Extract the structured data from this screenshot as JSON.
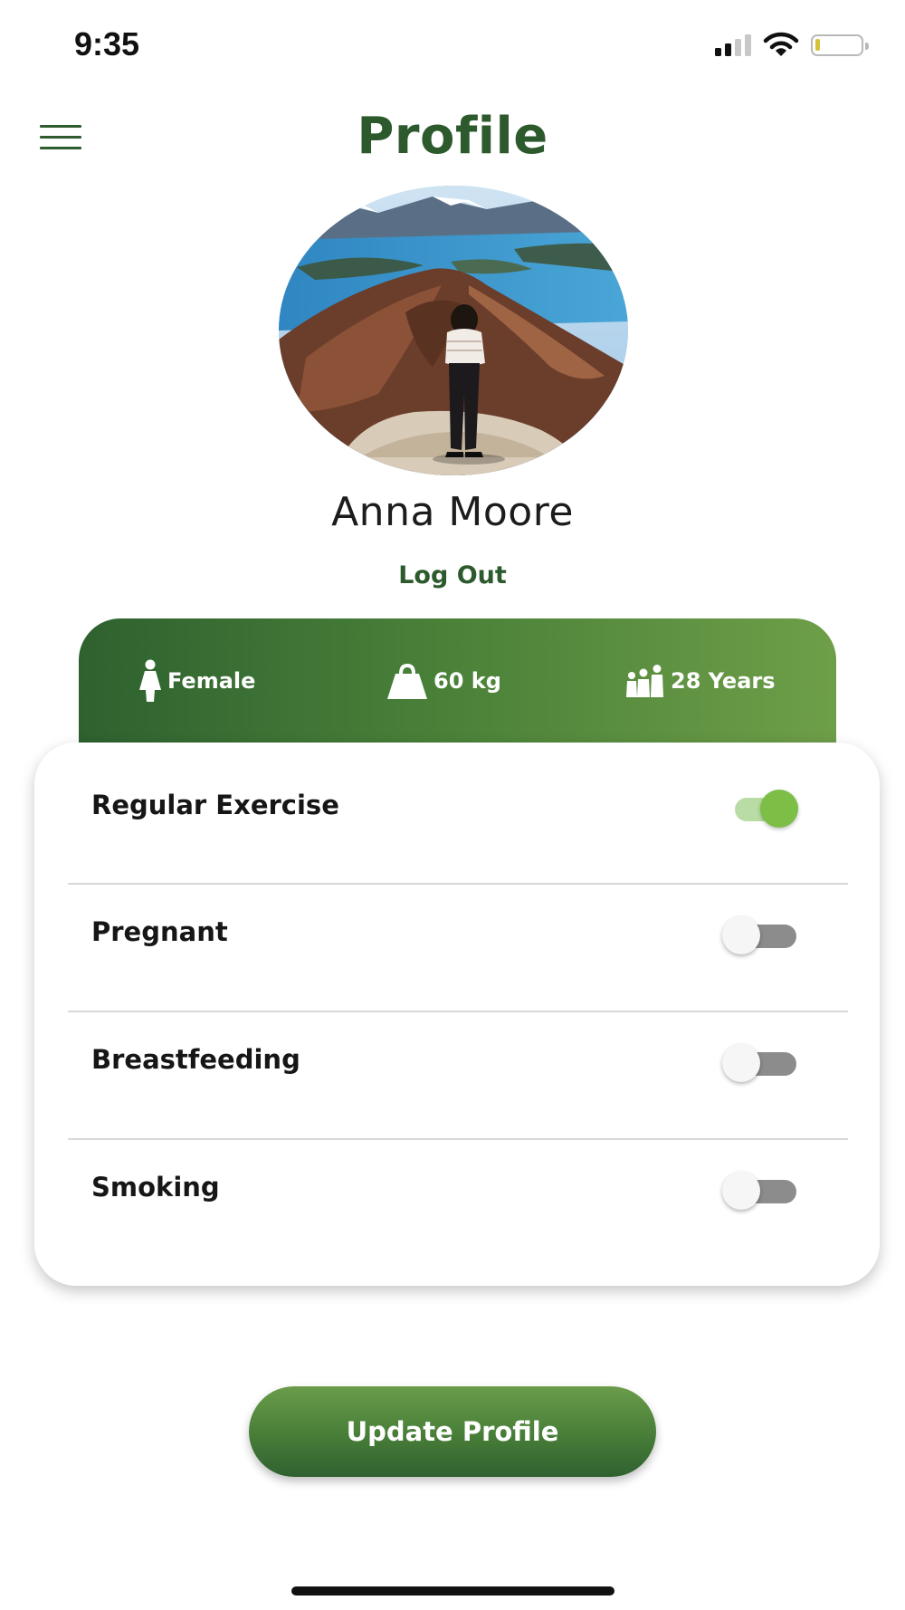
{
  "status_bar": {
    "time": "9:35",
    "icons": [
      "cellular-signal-icon",
      "wifi-icon",
      "battery-icon"
    ]
  },
  "header": {
    "menu_icon": "hamburger-menu-icon",
    "title": "Profile"
  },
  "profile": {
    "name": "Anna Moore",
    "logout_label": "Log Out"
  },
  "stats": [
    {
      "icon": "female-icon",
      "label": "Female"
    },
    {
      "icon": "weight-icon",
      "label": "60 kg"
    },
    {
      "icon": "family-icon",
      "label": "28 Years"
    }
  ],
  "settings": [
    {
      "label": "Regular Exercise",
      "enabled": true
    },
    {
      "label": "Pregnant",
      "enabled": false
    },
    {
      "label": "Breastfeeding",
      "enabled": false
    },
    {
      "label": "Smoking",
      "enabled": false
    }
  ],
  "actions": {
    "update_label": "Update Profile"
  },
  "colors": {
    "brand_green": "#2d5a2d",
    "toggle_on": "#7cbe46",
    "toggle_off_track": "#8c8c8c"
  }
}
